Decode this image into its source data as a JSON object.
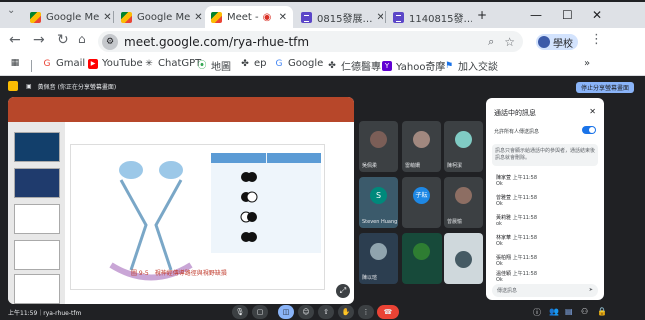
{
  "tabs": [
    {
      "title": "Google Me"
    },
    {
      "title": "Google Me"
    },
    {
      "title": "Meet -"
    },
    {
      "title": "0815發展…"
    },
    {
      "title": "1140815發…"
    }
  ],
  "url": "meet.google.com/rya-rhue-tfm",
  "profile_label": "學校",
  "bookmarks": [
    "Gmail",
    "YouTube",
    "ChatGPT",
    "地圖",
    "ep",
    "Google",
    "仁德醫專",
    "Yahoo奇摩",
    "加入交談"
  ],
  "meet": {
    "banner": "黃佩音 (你正在分享螢幕畫面)",
    "stop_share": "停止分享螢幕畫面",
    "slide_caption": "圖 9-5　視神經傳導路徑與視野缺損",
    "meeting_code": "上午11:59｜rya-rhue-tfm",
    "participants": [
      "吳佩柔",
      "雷萌姍",
      "陳柯潔",
      "S",
      "子耘",
      "曾晨愉",
      "陳以瑄",
      "Steven Huang"
    ]
  },
  "chat": {
    "title": "通話中的訊息",
    "toggle_label": "允許所有人傳送訊息",
    "notice": "訊息只會顯示給通話中的參與者，通話結束後訊息就會刪除。",
    "messages": [
      {
        "name": "陳家萱",
        "time": "上午11:58",
        "text": "Ok"
      },
      {
        "name": "曾雅萱",
        "time": "上午11:58",
        "text": "Ok"
      },
      {
        "name": "黃莉雅",
        "time": "上午11:58",
        "text": "ok"
      },
      {
        "name": "林家華",
        "time": "上午11:58",
        "text": "Ok"
      },
      {
        "name": "張柏翔",
        "time": "上午11:58",
        "text": "Ok"
      },
      {
        "name": "溫佳穎",
        "time": "上午11:58",
        "text": "Ok"
      }
    ],
    "input_placeholder": "傳送訊息"
  }
}
